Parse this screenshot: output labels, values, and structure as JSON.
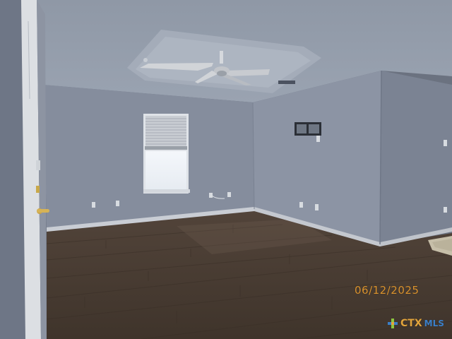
{
  "photo": {
    "date_stamp": "06/12/2025",
    "watermark": {
      "brand": "CTX",
      "suffix": "MLS"
    }
  },
  "colors": {
    "wall_left": "#7e8796",
    "wall_back": "#8890a0",
    "wall_right": "#7a8292",
    "ceiling": "#909aa8",
    "floor": "#4a3d33",
    "baseboard": "#c9cdd4",
    "stamp": "#d9922e",
    "brand_orange": "#e2a43c",
    "brand_blue": "#3a7fc8"
  },
  "icons": [
    "ceiling-fan-icon",
    "window-blind-icon",
    "door-handle-icon",
    "mls-logo-icon"
  ]
}
